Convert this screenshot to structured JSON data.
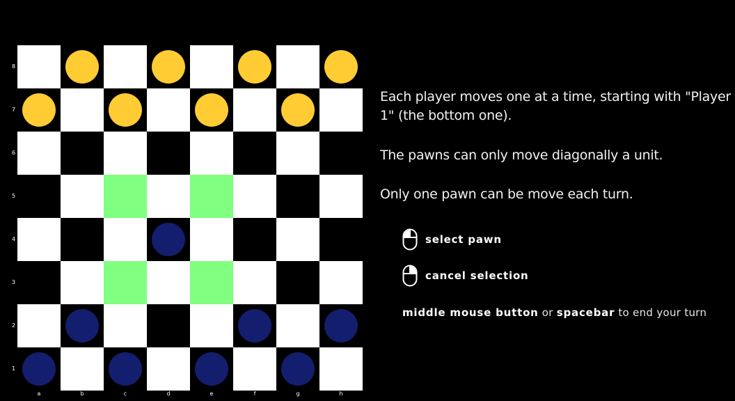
{
  "colors": {
    "light_square": "#ffffff",
    "dark_square": "#000000",
    "highlight_square": "#80ff80",
    "player_top_pawn": "#ffcc33",
    "player_bottom_pawn": "#141e6e",
    "background": "#000000"
  },
  "board": {
    "files": [
      "a",
      "b",
      "c",
      "d",
      "e",
      "f",
      "g",
      "h"
    ],
    "ranks": [
      "8",
      "7",
      "6",
      "5",
      "4",
      "3",
      "2",
      "1"
    ],
    "highlighted_squares": [
      "c5",
      "e5",
      "c3",
      "e3"
    ],
    "yellow_pawns": [
      "b8",
      "d8",
      "f8",
      "h8",
      "a7",
      "c7",
      "e7",
      "g7"
    ],
    "blue_pawns": [
      "d4",
      "b2",
      "f2",
      "h2",
      "a1",
      "c1",
      "e1",
      "g1"
    ]
  },
  "rules": {
    "line1": "Each player moves one at a time, starting with \"Player 1\" (the bottom one).",
    "line2": "The pawns can only move diagonally a unit.",
    "line3": "Only one pawn can be move each turn."
  },
  "controls": {
    "select": {
      "icon": "mouse-left-click-icon",
      "label": "select pawn"
    },
    "cancel": {
      "icon": "mouse-right-click-icon",
      "label": "cancel selection"
    },
    "end_turn": {
      "key1": "middle mouse button",
      "or": "or",
      "key2": "spacebar",
      "suffix": "to end your turn"
    }
  }
}
